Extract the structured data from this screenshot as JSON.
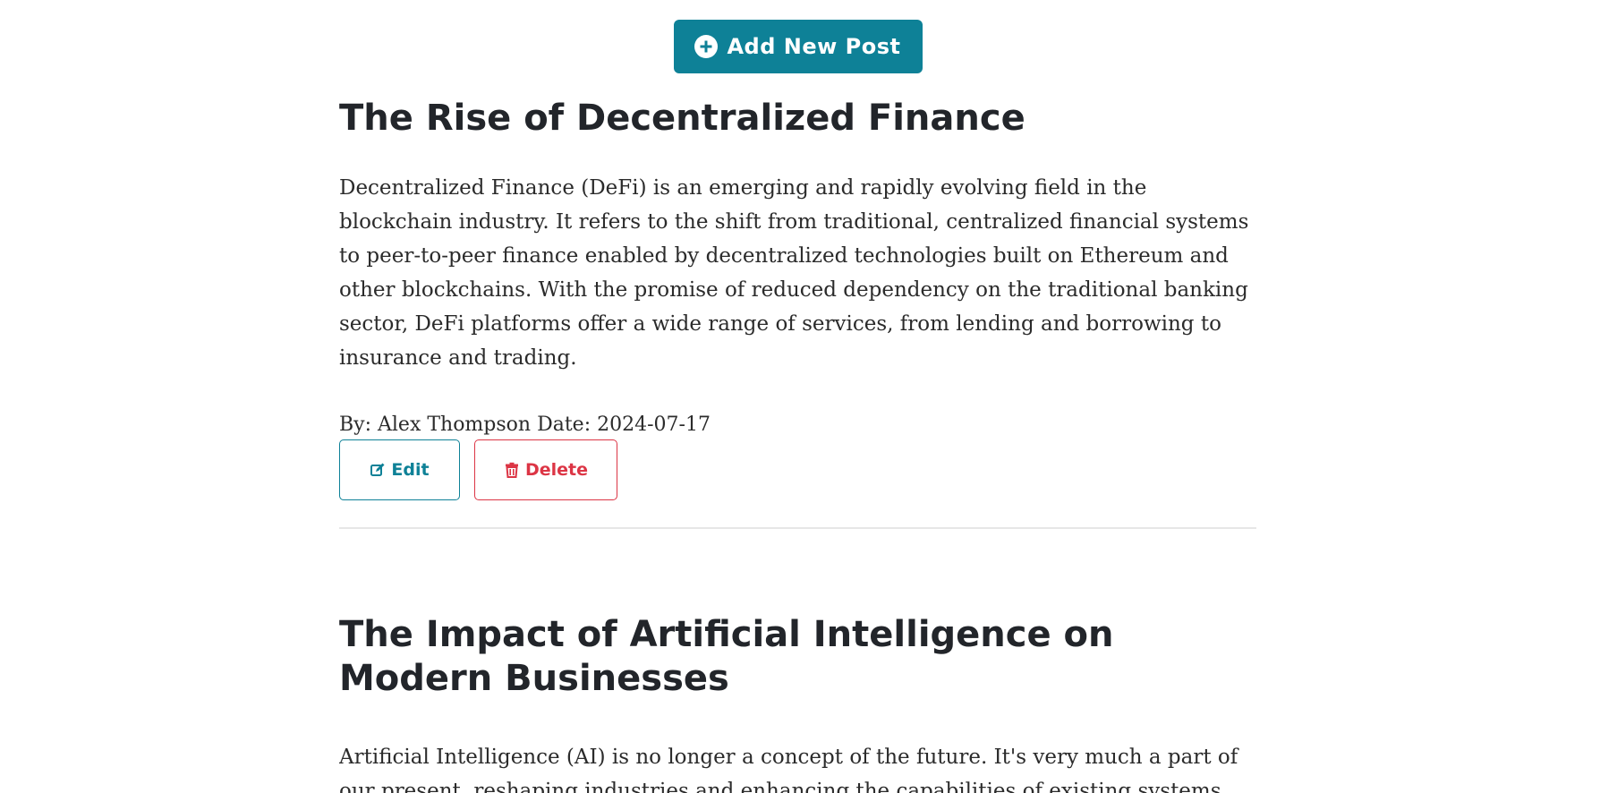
{
  "colors": {
    "accent": "#0e8197",
    "danger": "#dc3545"
  },
  "toolbar": {
    "add_post_label": "Add New Post",
    "add_post_icon": "plus-circle-icon"
  },
  "posts": [
    {
      "title": "The Rise of Decentralized Finance",
      "body": "Decentralized Finance (DeFi) is an emerging and rapidly evolving field in the blockchain industry. It refers to the shift from traditional, centralized financial systems to peer-to-peer finance enabled by decentralized technologies built on Ethereum and other blockchains. With the promise of reduced dependency on the traditional banking sector, DeFi platforms offer a wide range of services, from lending and borrowing to insurance and trading.",
      "meta": "By: Alex Thompson Date: 2024-07-17",
      "edit_label": "Edit",
      "edit_icon": "edit-icon",
      "delete_label": "Delete",
      "delete_icon": "trash-icon"
    },
    {
      "title": "The Impact of Artificial Intelligence on Modern Businesses",
      "body": "Artificial Intelligence (AI) is no longer a concept of the future. It's very much a part of our present, reshaping industries and enhancing the capabilities of existing systems."
    }
  ]
}
